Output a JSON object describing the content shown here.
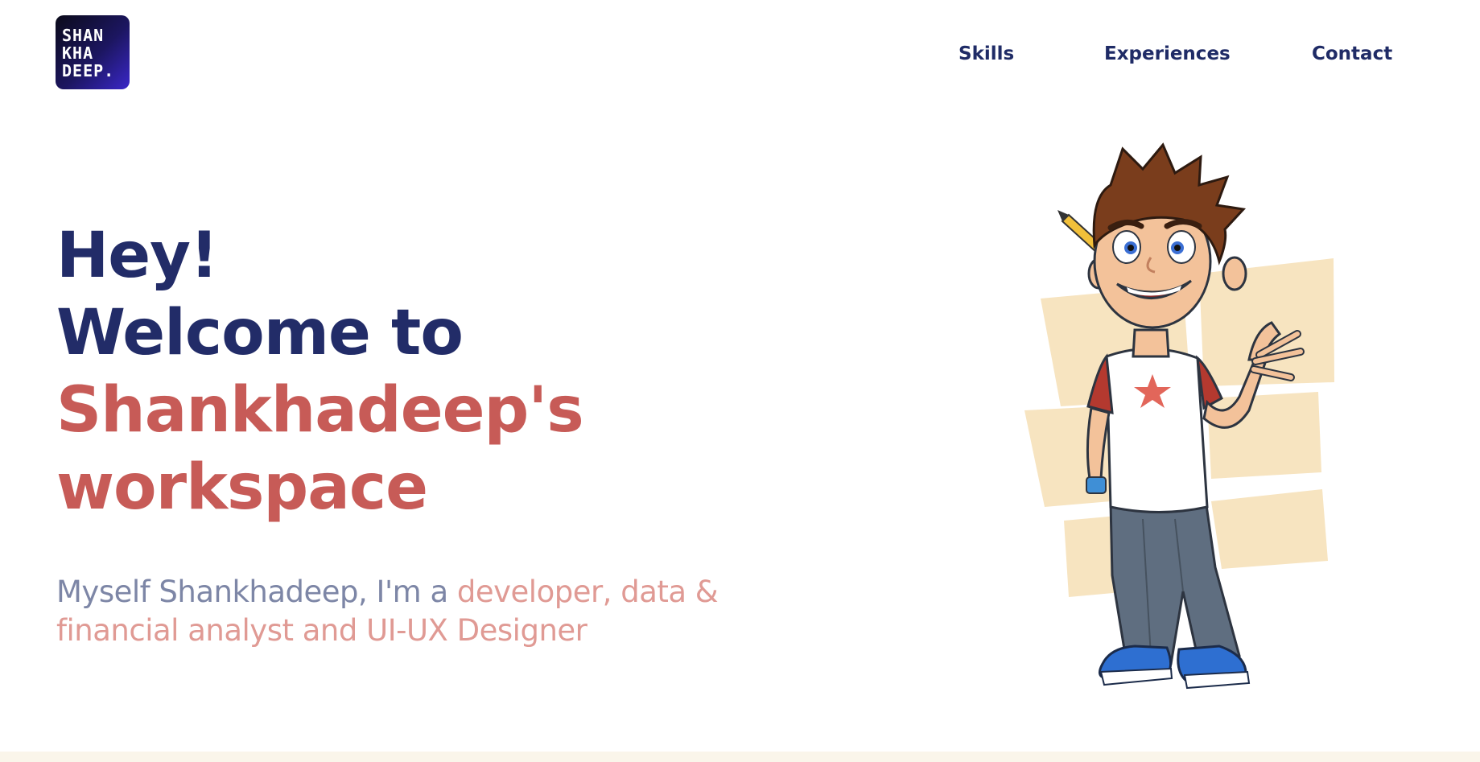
{
  "logo": {
    "line1": "SHAN",
    "line2": "KHA",
    "line3": "DEEP."
  },
  "nav": {
    "skills": "Skills",
    "experiences": "Experiences",
    "contact": "Contact"
  },
  "hero": {
    "line1": "Hey!",
    "line2": "Welcome to",
    "line3": "Shankhadeep's",
    "line4": "workspace"
  },
  "subtitle": {
    "intro": "Myself Shankhadeep, I'm a ",
    "roles": "developer, data & financial analyst and UI-UX Designer"
  },
  "colors": {
    "navy": "#222c68",
    "accent_red": "#c75b57",
    "muted": "#7d86a6",
    "pink": "#e09a94",
    "cream": "#f7e4c0"
  }
}
